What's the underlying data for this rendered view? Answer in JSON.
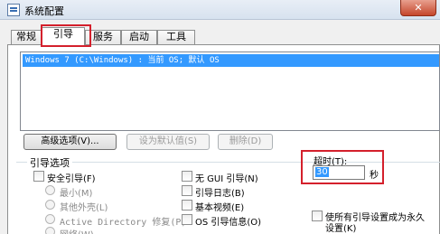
{
  "window": {
    "title": "系统配置",
    "close_glyph": "✕"
  },
  "tabs": [
    {
      "label": "常规"
    },
    {
      "label": "引导"
    },
    {
      "label": "服务"
    },
    {
      "label": "启动"
    },
    {
      "label": "工具"
    }
  ],
  "boot_list": {
    "items": [
      "Windows 7 (C:\\Windows) : 当前 OS; 默认 OS"
    ]
  },
  "buttons": {
    "advanced": "高级选项(V)...",
    "set_default": "设为默认值(S)",
    "delete": "删除(D)"
  },
  "boot_options": {
    "group_label": "引导选项",
    "safe_boot": "安全引导(F)",
    "minimal": "最小(M)",
    "alternate_shell": "其他外壳(L)",
    "active_directory": "Active Directory 修复(P)",
    "network": "网络(W)",
    "no_gui": "无 GUI 引导(N)",
    "boot_log": "引导日志(B)",
    "base_video": "基本视频(E)",
    "os_info": "OS 引导信息(O)"
  },
  "timeout": {
    "label": "超时(T):",
    "value": "30",
    "unit": "秒"
  },
  "permanent": {
    "label_line1": "使所有引导设置成为永久",
    "label_line2": "设置(K)"
  },
  "colors": {
    "highlight": "#3399ff",
    "annotation_red": "#d4202c"
  }
}
